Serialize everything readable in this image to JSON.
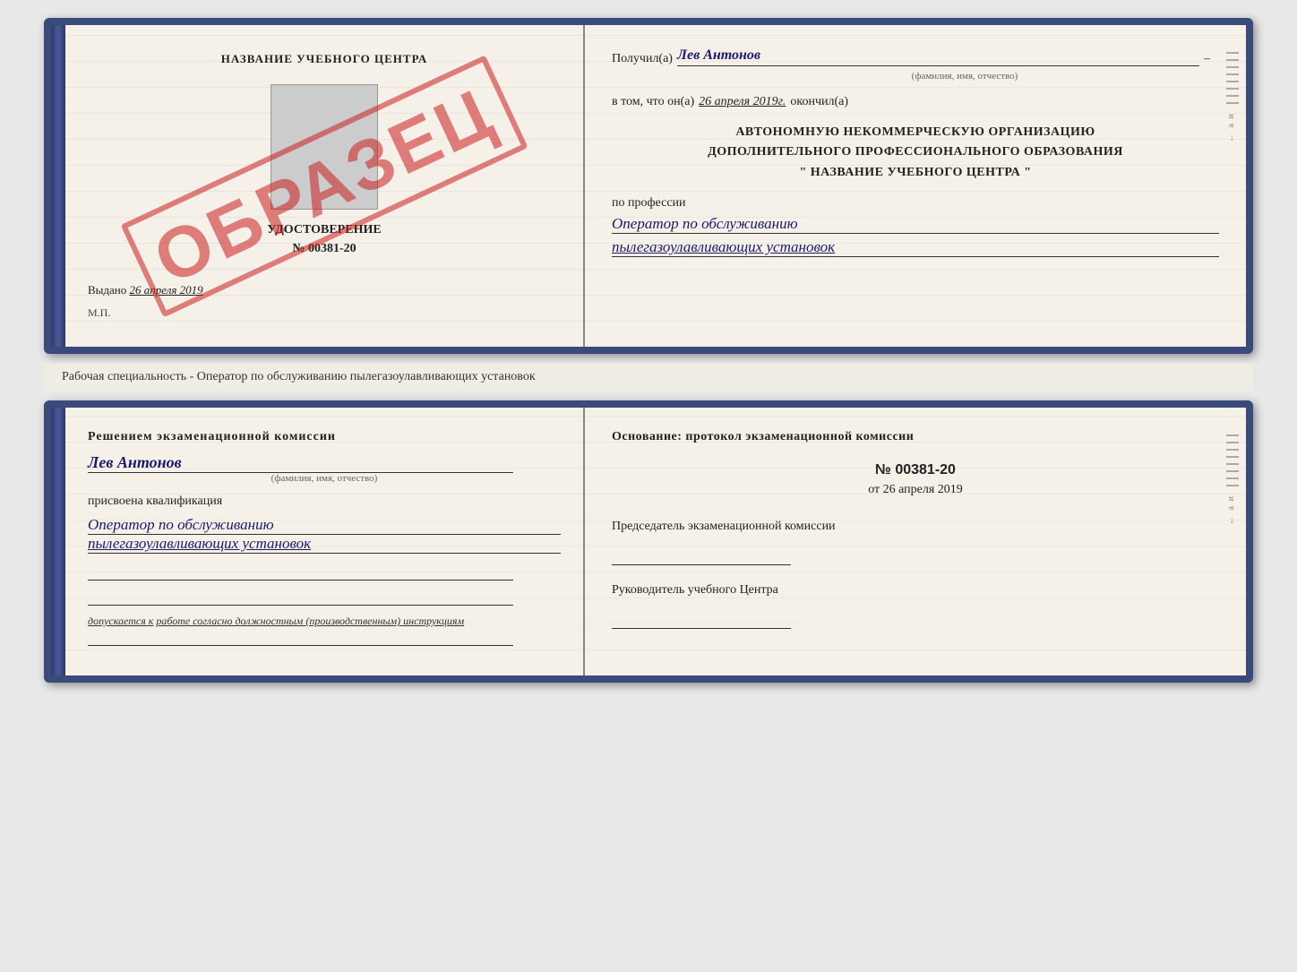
{
  "page": {
    "background": "#e8e8e8"
  },
  "certificate": {
    "left": {
      "title": "НАЗВАНИЕ УЧЕБНОГО ЦЕНТРА",
      "doc_type": "УДОСТОВЕРЕНИЕ",
      "number": "№ 00381-20",
      "issued_label": "Выдано",
      "issued_date": "26 апреля 2019",
      "stamp_text": "М.П.",
      "obrazets": "ОБРАЗЕЦ"
    },
    "right": {
      "recipient_prefix": "Получил(а)",
      "recipient_name": "Лев Антонов",
      "fio_label": "(фамилия, имя, отчество)",
      "date_prefix": "в том, что он(а)",
      "date_value": "26 апреля 2019г.",
      "date_suffix": "окончил(а)",
      "org_line1": "АВТОНОМНУЮ НЕКОММЕРЧЕСКУЮ ОРГАНИЗАЦИЮ",
      "org_line2": "ДОПОЛНИТЕЛЬНОГО ПРОФЕССИОНАЛЬНОГО ОБРАЗОВАНИЯ",
      "org_line3": "\" НАЗВАНИЕ УЧЕБНОГО ЦЕНТРА \"",
      "profession_label": "по профессии",
      "profession_line1": "Оператор по обслуживанию",
      "profession_line2": "пылегазоулавливающих установок"
    }
  },
  "middle": {
    "text": "Рабочая специальность - Оператор по обслуживанию пылегазоулавливающих установок"
  },
  "back_page": {
    "left": {
      "decision_title": "Решением экзаменационной комиссии",
      "name": "Лев Антонов",
      "fio_label": "(фамилия, имя, отчество)",
      "assigned_text": "присвоена квалификация",
      "qual_line1": "Оператор по обслуживанию",
      "qual_line2": "пылегазоулавливающих установок",
      "allowed_text": "допускается к",
      "allowed_work": "работе согласно должностным (производственным) инструкциям"
    },
    "right": {
      "basis_label": "Основание: протокол экзаменационной комиссии",
      "protocol_number": "№  00381-20",
      "date_prefix": "от",
      "date_value": "26 апреля 2019",
      "chair_title": "Председатель экзаменационной комиссии",
      "head_title": "Руководитель учебного Центра"
    }
  }
}
